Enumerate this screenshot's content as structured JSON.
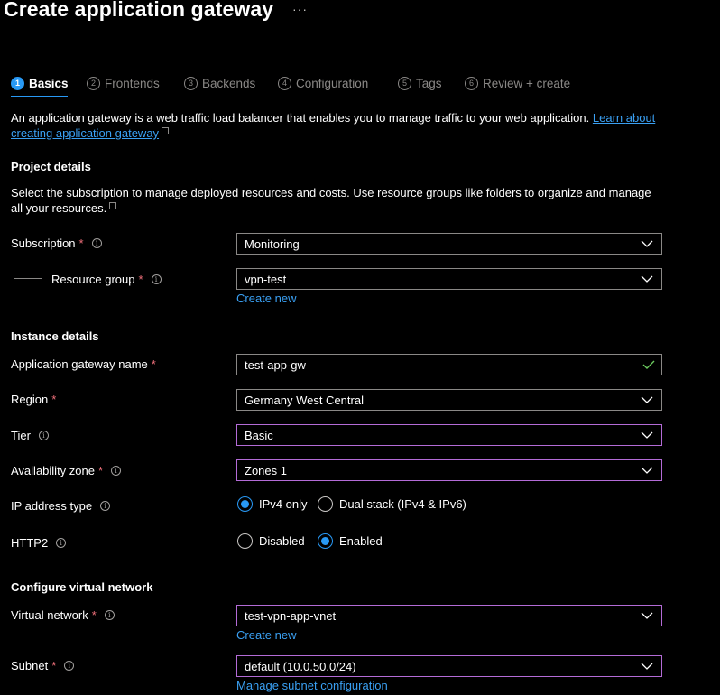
{
  "header": {
    "title": "Create application gateway",
    "more": "···"
  },
  "tabs": [
    {
      "num": "1",
      "label": "Basics"
    },
    {
      "num": "2",
      "label": "Frontends"
    },
    {
      "num": "3",
      "label": "Backends"
    },
    {
      "num": "4",
      "label": "Configuration"
    },
    {
      "num": "5",
      "label": "Tags"
    },
    {
      "num": "6",
      "label": "Review + create"
    }
  ],
  "intro": {
    "text": "An application gateway is a web traffic load balancer that enables you to manage traffic to your web application.",
    "link_part1": "Learn",
    "link_part2": "about creating application gateway"
  },
  "project": {
    "heading": "Project details",
    "description": "Select the subscription to manage deployed resources and costs. Use resource groups like folders to organize and manage all your resources.",
    "subscription_label": "Subscription",
    "subscription_value": "Monitoring",
    "resource_group_label": "Resource group",
    "resource_group_value": "vpn-test",
    "create_new": "Create new"
  },
  "instance": {
    "heading": "Instance details",
    "name_label": "Application gateway name",
    "name_value": "test-app-gw",
    "region_label": "Region",
    "region_value": "Germany West Central",
    "tier_label": "Tier",
    "tier_value": "Basic",
    "zone_label": "Availability zone",
    "zone_value": "Zones 1",
    "ip_label": "IP address type",
    "ip_options": [
      "IPv4 only",
      "Dual stack (IPv4 & IPv6)"
    ],
    "ip_selected": "IPv4 only",
    "http2_label": "HTTP2",
    "http2_options": [
      "Disabled",
      "Enabled"
    ],
    "http2_selected": "Enabled"
  },
  "network": {
    "heading": "Configure virtual network",
    "vnet_label": "Virtual network",
    "vnet_value": "test-vpn-app-vnet",
    "create_new": "Create new",
    "subnet_label": "Subnet",
    "subnet_value": "default (10.0.50.0/24)",
    "manage_subnet": "Manage subnet configuration"
  },
  "colors": {
    "accent": "#2899f5",
    "link": "#3aa0f3",
    "required": "#f1707b",
    "focus_border": "#b36bd6",
    "valid_check": "#6ccb5f"
  }
}
